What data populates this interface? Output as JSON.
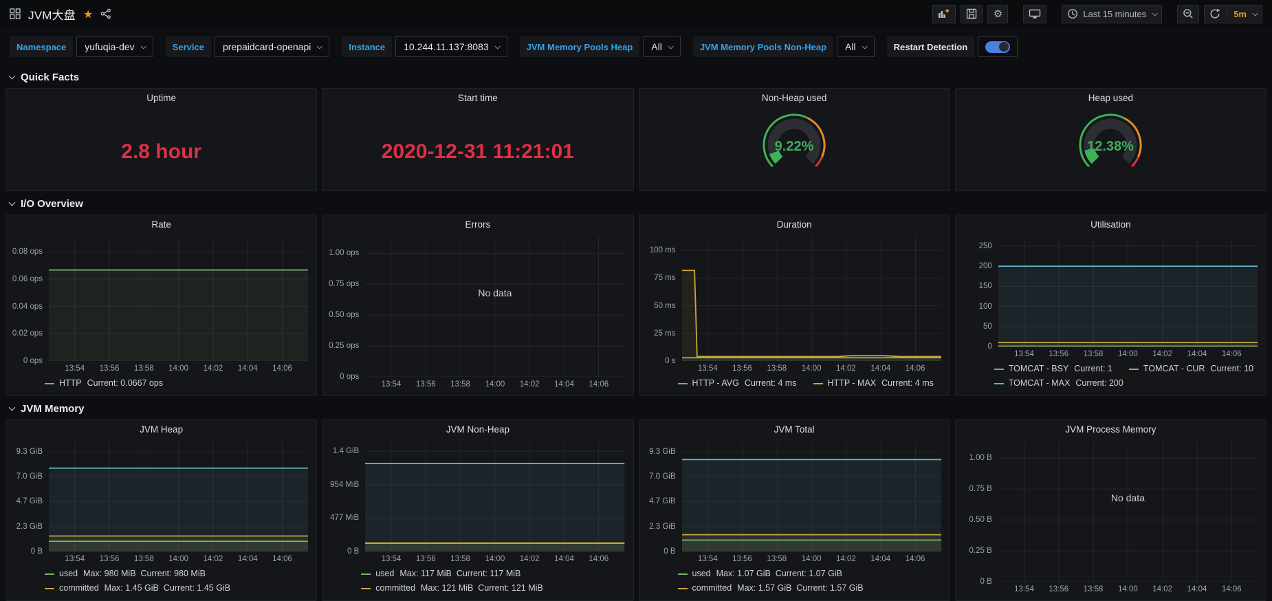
{
  "colors": {
    "stat_red": "#e02f44",
    "gauge_green": "#3eb15b",
    "accent_blue": "#35a2e8",
    "orange": "#ee9a1a",
    "toggle_blue": "#4d7fe0",
    "series_green": "#7eb26d",
    "series_yellow": "#c9a83c",
    "series_cyan": "#5fb6c5",
    "gauge_orange": "#eb8b1e",
    "gauge_red": "#e02f44",
    "grid": "#24262a"
  },
  "nav": {
    "title": "JVM大盘",
    "time_range": "Last 15 minutes",
    "refresh_interval": "5m"
  },
  "variables": [
    {
      "label": "Namespace",
      "value": "yufuqia-dev"
    },
    {
      "label": "Service",
      "value": "prepaidcard-openapi"
    },
    {
      "label": "Instance",
      "value": "10.244.11.137:8083"
    },
    {
      "label": "JVM Memory Pools Heap",
      "value": "All"
    },
    {
      "label": "JVM Memory Pools Non-Heap",
      "value": "All"
    }
  ],
  "restart": {
    "label": "Restart Detection",
    "enabled": true
  },
  "sections": [
    {
      "title": "Quick Facts",
      "panels": [
        {
          "type": "stat",
          "title": "Uptime",
          "value": "2.8 hour"
        },
        {
          "type": "stat",
          "title": "Start time",
          "value": "2020-12-31 11:21:01"
        },
        {
          "type": "gauge",
          "title": "Non-Heap used",
          "value": 9.22,
          "display": "9.22%"
        },
        {
          "type": "gauge",
          "title": "Heap used",
          "value": 12.38,
          "display": "12.38%"
        }
      ]
    },
    {
      "title": "I/O Overview",
      "panels": [
        {
          "type": "chart",
          "title": "Rate",
          "chart": {
            "kind": "line",
            "ylim": [
              0,
              0.0907
            ],
            "yticks": [
              {
                "v": 0.08,
                "label": "0.08 ops"
              },
              {
                "v": 0.06,
                "label": "0.06 ops"
              },
              {
                "v": 0.04,
                "label": "0.04 ops"
              },
              {
                "v": 0.02,
                "label": "0.02 ops"
              },
              {
                "v": 0,
                "label": "0 ops"
              }
            ],
            "xticks": [
              "13:54",
              "13:56",
              "13:58",
              "14:00",
              "14:02",
              "14:04",
              "14:06"
            ],
            "series": [
              {
                "name": "HTTP",
                "color": "#7eb26d",
                "points": [
                  [
                    0,
                    0.0667
                  ],
                  [
                    1,
                    0.0667
                  ]
                ],
                "legend": "Current: 0.0667 ops"
              }
            ]
          }
        },
        {
          "type": "chart",
          "title": "Errors",
          "chart": {
            "kind": "line",
            "ylim": [
              0,
              1.13
            ],
            "no_data": "No data",
            "yticks": [
              {
                "v": 1,
                "label": "1.00 ops"
              },
              {
                "v": 0.75,
                "label": "0.75 ops"
              },
              {
                "v": 0.5,
                "label": "0.50 ops"
              },
              {
                "v": 0.25,
                "label": "0.25 ops"
              },
              {
                "v": 0,
                "label": "0 ops"
              }
            ],
            "xticks": [
              "13:54",
              "13:56",
              "13:58",
              "14:00",
              "14:02",
              "14:04",
              "14:06"
            ],
            "series": []
          }
        },
        {
          "type": "chart",
          "title": "Duration",
          "chart": {
            "kind": "line",
            "ylim": [
              0,
              112
            ],
            "yticks": [
              {
                "v": 100,
                "label": "100 ms"
              },
              {
                "v": 75,
                "label": "75 ms"
              },
              {
                "v": 50,
                "label": "50 ms"
              },
              {
                "v": 25,
                "label": "25 ms"
              },
              {
                "v": 0,
                "label": "0 s"
              }
            ],
            "xticks": [
              "13:54",
              "13:56",
              "13:58",
              "14:00",
              "14:02",
              "14:04",
              "14:06"
            ],
            "series": [
              {
                "name": "HTTP - AVG",
                "color": "#7eb26d",
                "points": [
                  [
                    0,
                    3
                  ],
                  [
                    1,
                    3
                  ]
                ],
                "legend": "Current: 4 ms"
              },
              {
                "name": "HTTP - MAX",
                "color": "#c9a83c",
                "points": [
                  [
                    0,
                    82
                  ],
                  [
                    0.048,
                    82
                  ],
                  [
                    0.058,
                    4
                  ],
                  [
                    0.6,
                    4
                  ],
                  [
                    0.65,
                    4.8
                  ],
                  [
                    0.78,
                    4.8
                  ],
                  [
                    0.84,
                    4
                  ],
                  [
                    1,
                    4
                  ]
                ],
                "legend": "Current: 4 ms"
              }
            ]
          }
        },
        {
          "type": "chart",
          "title": "Utilisation",
          "chart": {
            "kind": "line",
            "ylim": [
              0,
              272
            ],
            "yticks": [
              {
                "v": 250,
                "label": "250"
              },
              {
                "v": 200,
                "label": "200"
              },
              {
                "v": 150,
                "label": "150"
              },
              {
                "v": 100,
                "label": "100"
              },
              {
                "v": 50,
                "label": "50"
              },
              {
                "v": 0,
                "label": "0"
              }
            ],
            "xticks": [
              "13:54",
              "13:56",
              "13:58",
              "14:00",
              "14:02",
              "14:04",
              "14:06"
            ],
            "series": [
              {
                "name": "TOMCAT - BSY",
                "color": "#7eb26d",
                "points": [
                  [
                    0,
                    1
                  ],
                  [
                    1,
                    1
                  ]
                ],
                "legend": "Current: 1"
              },
              {
                "name": "TOMCAT - CUR",
                "color": "#c9a83c",
                "points": [
                  [
                    0,
                    10
                  ],
                  [
                    1,
                    10
                  ]
                ],
                "legend": "Current: 10"
              },
              {
                "name": "TOMCAT - MAX",
                "color": "#5fb6c5",
                "points": [
                  [
                    0,
                    200
                  ],
                  [
                    1,
                    200
                  ]
                ],
                "legend": "Current: 200"
              }
            ]
          }
        }
      ]
    },
    {
      "title": "JVM Memory",
      "panels": [
        {
          "type": "chart",
          "title": "JVM Heap",
          "chart": {
            "kind": "line",
            "ylim": [
              0,
              10.23
            ],
            "yticks": [
              {
                "v": 9.3,
                "label": "9.3 GiB"
              },
              {
                "v": 7.0,
                "label": "7.0 GiB"
              },
              {
                "v": 4.7,
                "label": "4.7 GiB"
              },
              {
                "v": 2.3,
                "label": "2.3 GiB"
              },
              {
                "v": 0,
                "label": "0 B"
              }
            ],
            "xticks": [
              "13:54",
              "13:56",
              "13:58",
              "14:00",
              "14:02",
              "14:04",
              "14:06"
            ],
            "series": [
              {
                "name": "used",
                "color": "#7eb26d",
                "points": [
                  [
                    0,
                    0.957
                  ],
                  [
                    1,
                    0.957
                  ]
                ],
                "legend": "Max: 980 MiB  Current: 980 MiB"
              },
              {
                "name": "committed",
                "color": "#c9a83c",
                "points": [
                  [
                    0,
                    1.45
                  ],
                  [
                    1,
                    1.45
                  ]
                ],
                "legend": "Max: 1.45 GiB  Current: 1.45 GiB"
              },
              {
                "name": "max",
                "color": "#5fb6c5",
                "points": [
                  [
                    0,
                    7.8
                  ],
                  [
                    1,
                    7.8
                  ]
                ]
              }
            ]
          }
        },
        {
          "type": "chart",
          "title": "JVM Non-Heap",
          "chart": {
            "kind": "line",
            "ylim": [
              0,
              1560
            ],
            "yticks": [
              {
                "v": 1431,
                "label": "1.4 GiB"
              },
              {
                "v": 954,
                "label": "954 MiB"
              },
              {
                "v": 477,
                "label": "477 MiB"
              },
              {
                "v": 0,
                "label": "0 B"
              }
            ],
            "xticks": [
              "13:54",
              "13:56",
              "13:58",
              "14:00",
              "14:02",
              "14:04",
              "14:06"
            ],
            "series": [
              {
                "name": "used",
                "color": "#7eb26d",
                "points": [
                  [
                    0,
                    117
                  ],
                  [
                    1,
                    117
                  ]
                ],
                "legend": "Max: 117 MiB  Current: 117 MiB"
              },
              {
                "name": "committed",
                "color": "#c9a83c",
                "points": [
                  [
                    0,
                    121
                  ],
                  [
                    1,
                    121
                  ]
                ],
                "legend": "Max: 121 MiB  Current: 121 MiB"
              },
              {
                "name": "max",
                "color": "#5fb6c5",
                "points": [
                  [
                    0,
                    1255
                  ],
                  [
                    1,
                    1255
                  ]
                ]
              }
            ]
          }
        },
        {
          "type": "chart",
          "title": "JVM Total",
          "chart": {
            "kind": "line",
            "ylim": [
              0,
              10.23
            ],
            "yticks": [
              {
                "v": 9.3,
                "label": "9.3 GiB"
              },
              {
                "v": 7.0,
                "label": "7.0 GiB"
              },
              {
                "v": 4.7,
                "label": "4.7 GiB"
              },
              {
                "v": 2.3,
                "label": "2.3 GiB"
              },
              {
                "v": 0,
                "label": "0 B"
              }
            ],
            "xticks": [
              "13:54",
              "13:56",
              "13:58",
              "14:00",
              "14:02",
              "14:04",
              "14:06"
            ],
            "series": [
              {
                "name": "used",
                "color": "#7eb26d",
                "points": [
                  [
                    0,
                    1.07
                  ],
                  [
                    1,
                    1.07
                  ]
                ],
                "legend": "Max: 1.07 GiB  Current: 1.07 GiB"
              },
              {
                "name": "committed",
                "color": "#c9a83c",
                "points": [
                  [
                    0,
                    1.57
                  ],
                  [
                    1,
                    1.57
                  ]
                ],
                "legend": "Max: 1.57 GiB  Current: 1.57 GiB"
              },
              {
                "name": "max",
                "color": "#5fb6c5",
                "points": [
                  [
                    0,
                    8.6
                  ],
                  [
                    1,
                    8.6
                  ]
                ]
              }
            ]
          }
        },
        {
          "type": "chart",
          "title": "JVM Process Memory",
          "chart": {
            "kind": "line",
            "ylim": [
              0,
              1.13
            ],
            "no_data": "No data",
            "yticks": [
              {
                "v": 1,
                "label": "1.00 B"
              },
              {
                "v": 0.75,
                "label": "0.75 B"
              },
              {
                "v": 0.5,
                "label": "0.50 B"
              },
              {
                "v": 0.25,
                "label": "0.25 B"
              },
              {
                "v": 0,
                "label": "0 B"
              }
            ],
            "xticks": [
              "13:54",
              "13:56",
              "13:58",
              "14:00",
              "14:02",
              "14:04",
              "14:06"
            ],
            "series": []
          }
        }
      ]
    }
  ]
}
